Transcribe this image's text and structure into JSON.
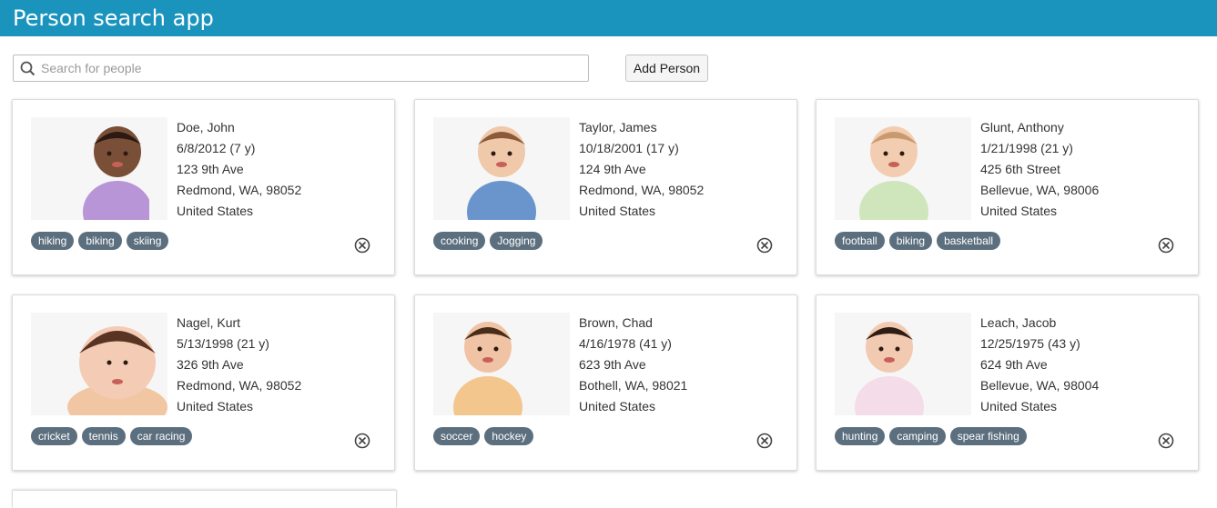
{
  "app": {
    "title": "Person search app"
  },
  "search": {
    "placeholder": "Search for people",
    "value": ""
  },
  "toolbar": {
    "add_label": "Add Person"
  },
  "colors": {
    "header": "#1b94bd",
    "tag": "#5c6f7e"
  },
  "people": [
    {
      "name": "Doe, John",
      "dob": "6/8/2012 (7 y)",
      "address": "123 9th Ave",
      "city": "Redmond, WA, 98052",
      "country": "United States",
      "tags": [
        "hiking",
        "biking",
        "skiing"
      ]
    },
    {
      "name": "Taylor, James",
      "dob": "10/18/2001 (17 y)",
      "address": "124 9th Ave",
      "city": "Redmond, WA, 98052",
      "country": "United States",
      "tags": [
        "cooking",
        "Jogging"
      ]
    },
    {
      "name": "Glunt, Anthony",
      "dob": "1/21/1998 (21 y)",
      "address": "425 6th Street",
      "city": "Bellevue, WA, 98006",
      "country": "United States",
      "tags": [
        "football",
        "biking",
        "basketball"
      ]
    },
    {
      "name": "Nagel, Kurt",
      "dob": "5/13/1998 (21 y)",
      "address": "326 9th Ave",
      "city": "Redmond, WA, 98052",
      "country": "United States",
      "tags": [
        "cricket",
        "tennis",
        "car racing"
      ]
    },
    {
      "name": "Brown, Chad",
      "dob": "4/16/1978 (41 y)",
      "address": "623 9th Ave",
      "city": "Bothell, WA, 98021",
      "country": "United States",
      "tags": [
        "soccer",
        "hockey"
      ]
    },
    {
      "name": "Leach, Jacob",
      "dob": "12/25/1975 (43 y)",
      "address": "624 9th Ave",
      "city": "Bellevue, WA, 98004",
      "country": "United States",
      "tags": [
        "hunting",
        "camping",
        "spear fishing"
      ]
    }
  ]
}
